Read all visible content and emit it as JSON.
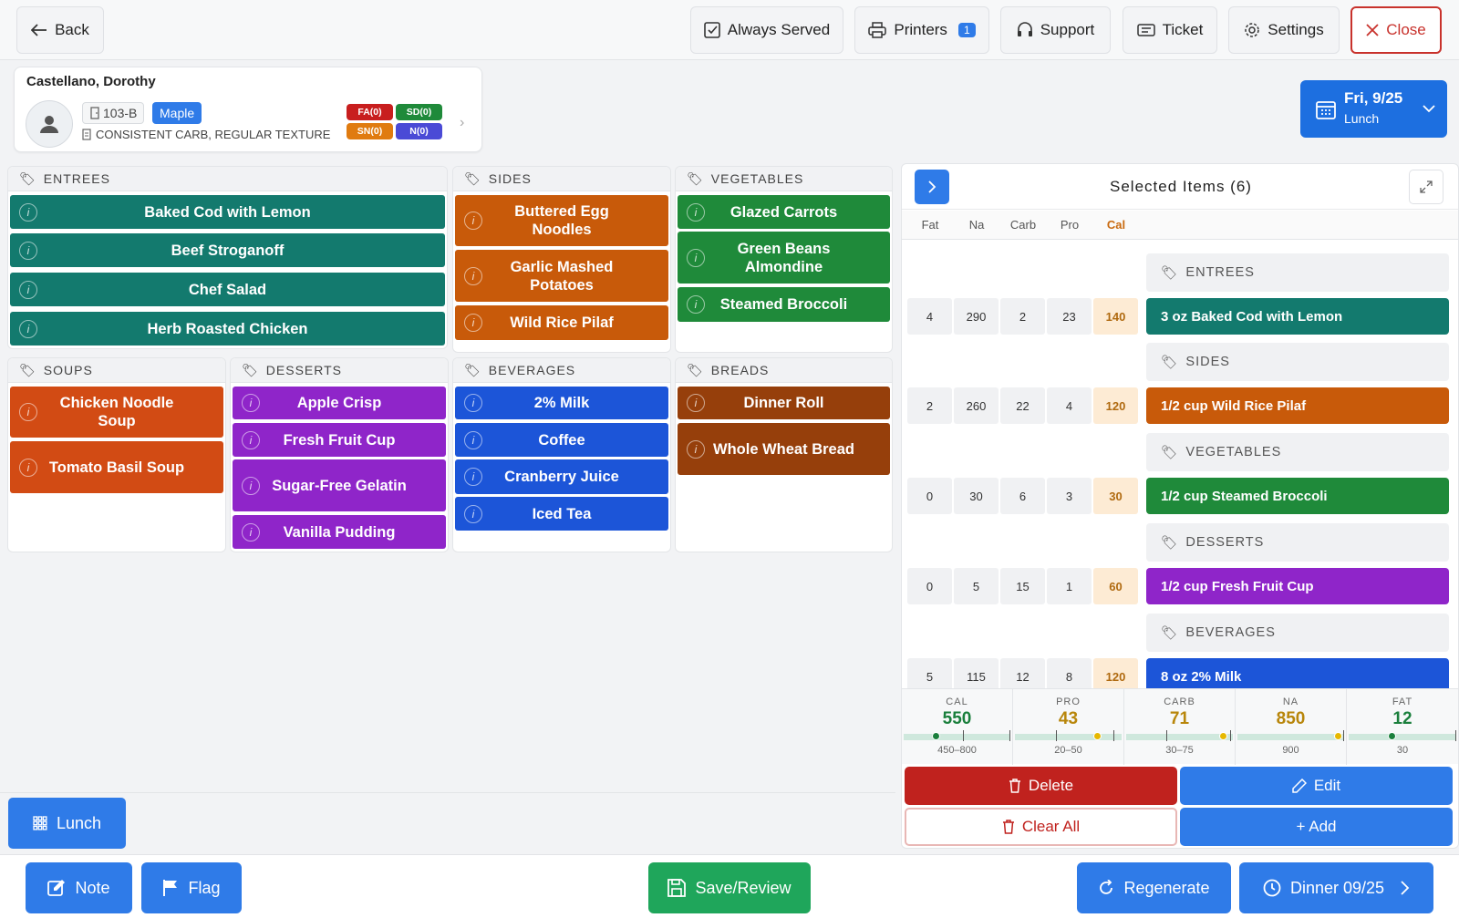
{
  "header": {
    "back": "Back",
    "always_served": "Always Served",
    "printers": "Printers",
    "printers_count": "1",
    "support": "Support",
    "ticket": "Ticket",
    "settings": "Settings",
    "close": "Close"
  },
  "patient": {
    "name": "Castellano, Dorothy",
    "room": "103-B",
    "unit": "Maple",
    "diet": "CONSISTENT CARB, REGULAR TEXTURE",
    "tags": [
      {
        "label": "FA(0)",
        "color": "#c81e1e"
      },
      {
        "label": "SD(0)",
        "color": "#1f8a3a"
      },
      {
        "label": "SN(0)",
        "color": "#e07b10"
      },
      {
        "label": "N(0)",
        "color": "#4a4ad6"
      }
    ]
  },
  "date": {
    "day": "Fri, 9/25",
    "meal": "Lunch"
  },
  "colors": {
    "entree": "#137a6e",
    "side": "#c85a0a",
    "vegetable": "#1f8a3a",
    "soup": "#d24b14",
    "dessert": "#8f25c9",
    "beverage": "#1c55d8",
    "bread": "#963f0b",
    "primary": "#2f7be8",
    "danger": "#c0221e",
    "save": "#1fa65b"
  },
  "categories": {
    "entrees": {
      "title": "ENTREES",
      "items": [
        "Baked Cod with Lemon",
        "Beef Stroganoff",
        "Chef Salad",
        "Herb Roasted Chicken"
      ]
    },
    "sides": {
      "title": "SIDES",
      "items": [
        "Buttered Egg Noodles",
        "Garlic Mashed Potatoes",
        "Wild Rice Pilaf"
      ]
    },
    "vegetables": {
      "title": "VEGETABLES",
      "items": [
        "Glazed Carrots",
        "Green Beans Almondine",
        "Steamed Broccoli"
      ]
    },
    "soups": {
      "title": "SOUPS",
      "items": [
        "Chicken Noodle Soup",
        "Tomato Basil Soup"
      ]
    },
    "desserts": {
      "title": "DESSERTS",
      "items": [
        "Apple Crisp",
        "Fresh Fruit Cup",
        "Sugar-Free Gelatin",
        "Vanilla Pudding"
      ]
    },
    "beverages": {
      "title": "BEVERAGES",
      "items": [
        "2% Milk",
        "Coffee",
        "Cranberry Juice",
        "Iced Tea"
      ]
    },
    "breads": {
      "title": "BREADS",
      "items": [
        "Dinner Roll",
        "Whole Wheat Bread"
      ]
    }
  },
  "selected": {
    "title": "Selected Items (6)",
    "columns": [
      "Fat",
      "Na",
      "Carb",
      "Pro",
      "Cal"
    ],
    "groups": [
      {
        "section": "ENTREES",
        "item": "3 oz Baked Cod with Lemon",
        "values": [
          "4",
          "290",
          "2",
          "23",
          "140"
        ],
        "color": "#137a6e"
      },
      {
        "section": "SIDES",
        "item": "1/2 cup Wild Rice Pilaf",
        "values": [
          "2",
          "260",
          "22",
          "4",
          "120"
        ],
        "color": "#c85a0a"
      },
      {
        "section": "VEGETABLES",
        "item": "1/2 cup Steamed Broccoli",
        "values": [
          "0",
          "30",
          "6",
          "3",
          "30"
        ],
        "color": "#1f8a3a"
      },
      {
        "section": "DESSERTS",
        "item": "1/2 cup Fresh Fruit Cup",
        "values": [
          "0",
          "5",
          "15",
          "1",
          "60"
        ],
        "color": "#8f25c9"
      },
      {
        "section": "BEVERAGES",
        "item": "8 oz 2% Milk",
        "values": [
          "5",
          "115",
          "12",
          "8",
          "120"
        ],
        "color": "#1c55d8"
      }
    ]
  },
  "summary": [
    {
      "label": "CAL",
      "value": "550",
      "range": "450–800",
      "color": "#1a7f3c",
      "dot": "#1a7f3c",
      "level": 0.3
    },
    {
      "label": "PRO",
      "value": "43",
      "range": "20–50",
      "color": "#b8860b",
      "dot": "#e6b800",
      "level": 0.77
    },
    {
      "label": "CARB",
      "value": "71",
      "range": "30–75",
      "color": "#b8860b",
      "dot": "#e6b800",
      "level": 0.91
    },
    {
      "label": "NA",
      "value": "850",
      "range": "900",
      "color": "#b8860b",
      "dot": "#e6b800",
      "level": 0.94
    },
    {
      "label": "FAT",
      "value": "12",
      "range": "30",
      "color": "#1a7f3c",
      "dot": "#1a7f3c",
      "level": 0.4
    }
  ],
  "actions": {
    "delete": "Delete",
    "edit": "Edit",
    "clear_all": "Clear All",
    "add": "+ Add"
  },
  "footer": {
    "meal": "Lunch",
    "note": "Note",
    "flag": "Flag",
    "save": "Save/Review",
    "regenerate": "Regenerate",
    "next_meal": "Dinner 09/25"
  }
}
